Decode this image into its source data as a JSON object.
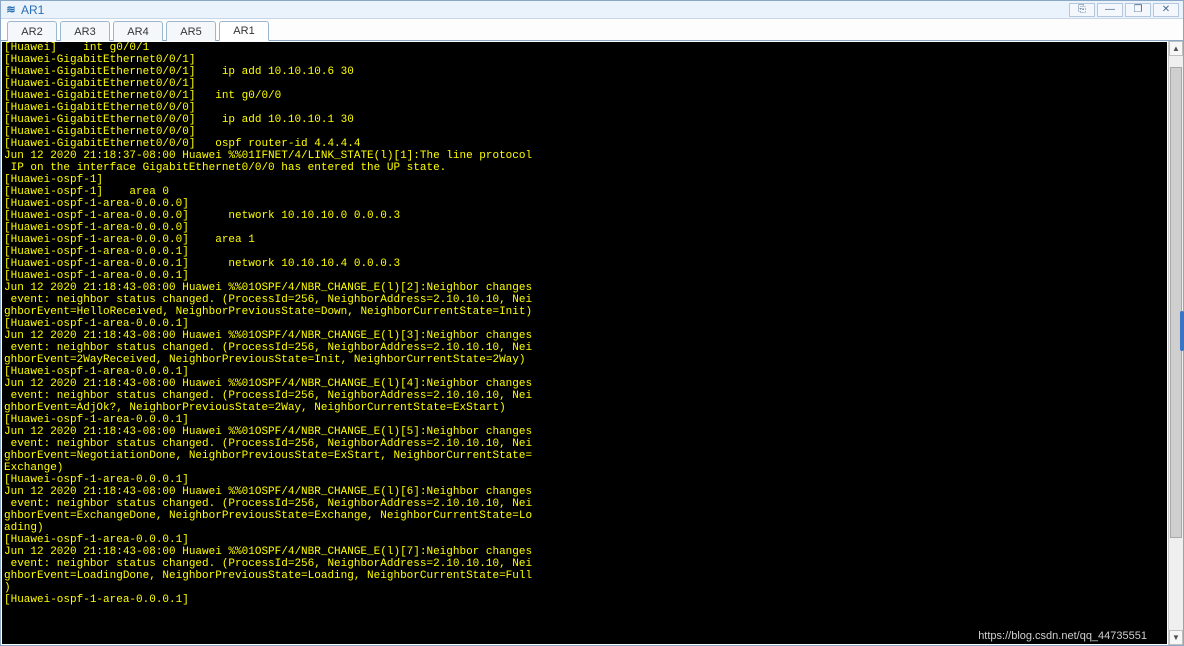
{
  "window": {
    "title": "AR1",
    "buttons": {
      "pin": "⎘",
      "min": "—",
      "max": "❐",
      "close": "✕"
    }
  },
  "tabs": [
    {
      "label": "AR2",
      "active": false
    },
    {
      "label": "AR3",
      "active": false
    },
    {
      "label": "AR4",
      "active": false
    },
    {
      "label": "AR5",
      "active": false
    },
    {
      "label": "AR1",
      "active": true
    }
  ],
  "scrollbar": {
    "thumb_top_pct": 2,
    "thumb_height_pct": 82
  },
  "watermark": "https://blog.csdn.net/qq_44735551",
  "terminal_lines": [
    "[Huawei]    int g0/0/1",
    "[Huawei-GigabitEthernet0/0/1]",
    "[Huawei-GigabitEthernet0/0/1]    ip add 10.10.10.6 30",
    "[Huawei-GigabitEthernet0/0/1]",
    "[Huawei-GigabitEthernet0/0/1]   int g0/0/0",
    "[Huawei-GigabitEthernet0/0/0]",
    "[Huawei-GigabitEthernet0/0/0]    ip add 10.10.10.1 30",
    "[Huawei-GigabitEthernet0/0/0]",
    "[Huawei-GigabitEthernet0/0/0]   ospf router-id 4.4.4.4",
    "Jun 12 2020 21:18:37-08:00 Huawei %%01IFNET/4/LINK_STATE(l)[1]:The line protocol",
    " IP on the interface GigabitEthernet0/0/0 has entered the UP state.",
    "[Huawei-ospf-1]",
    "[Huawei-ospf-1]    area 0",
    "[Huawei-ospf-1-area-0.0.0.0]",
    "[Huawei-ospf-1-area-0.0.0.0]      network 10.10.10.0 0.0.0.3",
    "[Huawei-ospf-1-area-0.0.0.0]",
    "[Huawei-ospf-1-area-0.0.0.0]    area 1",
    "[Huawei-ospf-1-area-0.0.0.1]",
    "[Huawei-ospf-1-area-0.0.0.1]      network 10.10.10.4 0.0.0.3",
    "[Huawei-ospf-1-area-0.0.0.1]",
    "Jun 12 2020 21:18:43-08:00 Huawei %%01OSPF/4/NBR_CHANGE_E(l)[2]:Neighbor changes",
    " event: neighbor status changed. (ProcessId=256, NeighborAddress=2.10.10.10, Nei",
    "ghborEvent=HelloReceived, NeighborPreviousState=Down, NeighborCurrentState=Init)",
    "",
    "[Huawei-ospf-1-area-0.0.0.1]",
    "Jun 12 2020 21:18:43-08:00 Huawei %%01OSPF/4/NBR_CHANGE_E(l)[3]:Neighbor changes",
    " event: neighbor status changed. (ProcessId=256, NeighborAddress=2.10.10.10, Nei",
    "ghborEvent=2WayReceived, NeighborPreviousState=Init, NeighborCurrentState=2Way)",
    "",
    "[Huawei-ospf-1-area-0.0.0.1]",
    "Jun 12 2020 21:18:43-08:00 Huawei %%01OSPF/4/NBR_CHANGE_E(l)[4]:Neighbor changes",
    " event: neighbor status changed. (ProcessId=256, NeighborAddress=2.10.10.10, Nei",
    "ghborEvent=AdjOk?, NeighborPreviousState=2Way, NeighborCurrentState=ExStart)",
    "[Huawei-ospf-1-area-0.0.0.1]",
    "Jun 12 2020 21:18:43-08:00 Huawei %%01OSPF/4/NBR_CHANGE_E(l)[5]:Neighbor changes",
    " event: neighbor status changed. (ProcessId=256, NeighborAddress=2.10.10.10, Nei",
    "ghborEvent=NegotiationDone, NeighborPreviousState=ExStart, NeighborCurrentState=",
    "Exchange)",
    "[Huawei-ospf-1-area-0.0.0.1]",
    "Jun 12 2020 21:18:43-08:00 Huawei %%01OSPF/4/NBR_CHANGE_E(l)[6]:Neighbor changes",
    " event: neighbor status changed. (ProcessId=256, NeighborAddress=2.10.10.10, Nei",
    "ghborEvent=ExchangeDone, NeighborPreviousState=Exchange, NeighborCurrentState=Lo",
    "ading)",
    "[Huawei-ospf-1-area-0.0.0.1]",
    "Jun 12 2020 21:18:43-08:00 Huawei %%01OSPF/4/NBR_CHANGE_E(l)[7]:Neighbor changes",
    " event: neighbor status changed. (ProcessId=256, NeighborAddress=2.10.10.10, Nei",
    "ghborEvent=LoadingDone, NeighborPreviousState=Loading, NeighborCurrentState=Full",
    ")",
    "[Huawei-ospf-1-area-0.0.0.1]"
  ]
}
